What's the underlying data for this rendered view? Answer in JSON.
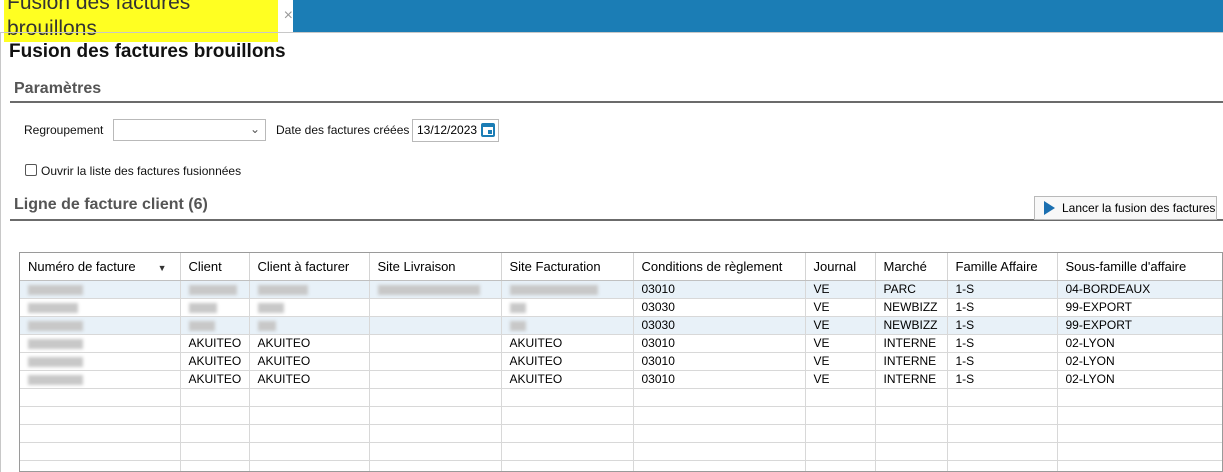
{
  "tab": {
    "title": "Fusion des factures brouillons",
    "close_icon": "×"
  },
  "page": {
    "title": "Fusion des factures brouillons"
  },
  "parametres": {
    "title": "Paramètres",
    "regroupement_label": "Regroupement",
    "regroupement_value": "",
    "date_label": "Date des factures créées",
    "date_value": "13/12/2023",
    "checkbox_label": "Ouvrir la liste des factures fusionnées",
    "checkbox_checked": false
  },
  "lignes": {
    "title": "Ligne de facture client (6)",
    "launch_button": "Lancer la fusion des factures"
  },
  "table": {
    "columns": [
      "Numéro de facture",
      "Client",
      "Client à facturer",
      "Site Livraison",
      "Site Facturation",
      "Conditions de règlement",
      "Journal",
      "Marché",
      "Famille Affaire",
      "Sous-famille d'affaire"
    ],
    "sort_indicator": "▼",
    "rows": [
      {
        "numero": "",
        "client": "",
        "client_facturer": "",
        "site_livraison": "",
        "site_facturation": "",
        "conditions": "03010",
        "journal": "VE",
        "marche": "PARC",
        "famille": "1-S",
        "sous_famille": "04-BORDEAUX"
      },
      {
        "numero": "",
        "client": "",
        "client_facturer": "",
        "site_livraison": "",
        "site_facturation": "",
        "conditions": "03030",
        "journal": "VE",
        "marche": "NEWBIZZ",
        "famille": "1-S",
        "sous_famille": "99-EXPORT"
      },
      {
        "numero": "",
        "client": "",
        "client_facturer": "",
        "site_livraison": "",
        "site_facturation": "",
        "conditions": "03030",
        "journal": "VE",
        "marche": "NEWBIZZ",
        "famille": "1-S",
        "sous_famille": "99-EXPORT"
      },
      {
        "numero": "",
        "client": "AKUITEO",
        "client_facturer": "AKUITEO",
        "site_livraison": "",
        "site_facturation": "AKUITEO",
        "conditions": "03010",
        "journal": "VE",
        "marche": "INTERNE",
        "famille": "1-S",
        "sous_famille": "02-LYON"
      },
      {
        "numero": "",
        "client": "AKUITEO",
        "client_facturer": "AKUITEO",
        "site_livraison": "",
        "site_facturation": "AKUITEO",
        "conditions": "03010",
        "journal": "VE",
        "marche": "INTERNE",
        "famille": "1-S",
        "sous_famille": "02-LYON"
      },
      {
        "numero": "",
        "client": "AKUITEO",
        "client_facturer": "AKUITEO",
        "site_livraison": "",
        "site_facturation": "AKUITEO",
        "conditions": "03010",
        "journal": "VE",
        "marche": "INTERNE",
        "famille": "1-S",
        "sous_famille": "02-LYON"
      }
    ]
  }
}
